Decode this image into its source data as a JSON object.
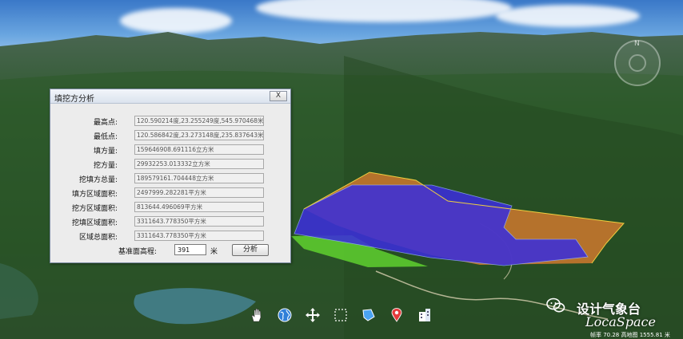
{
  "dialog": {
    "title": "填挖方分析",
    "close_label": "X",
    "fields": [
      {
        "label": "最高点:",
        "value": "120.590214度,23.255249度,545.970468米"
      },
      {
        "label": "最低点:",
        "value": "120.586842度,23.273148度,235.837643米"
      },
      {
        "label": "填方量:",
        "value": "159646908.691116立方米"
      },
      {
        "label": "挖方量:",
        "value": "29932253.013332立方米"
      },
      {
        "label": "挖填方总量:",
        "value": "189579161.704448立方米"
      },
      {
        "label": "填方区域面积:",
        "value": "2497999.282281平方米"
      },
      {
        "label": "挖方区域面积:",
        "value": "813644.496069平方米"
      },
      {
        "label": "挖填区域面积:",
        "value": "3311643.778350平方米"
      },
      {
        "label": "区域总面积:",
        "value": "3311643.778350平方米"
      }
    ],
    "base_label": "基准面高程:",
    "base_value": "391",
    "unit": "米",
    "analyze_button": "分析"
  },
  "toolbar": {
    "icons": [
      "hand-pan-icon",
      "globe-icon",
      "move-arrows-icon",
      "select-rectangle-icon",
      "area-measure-icon",
      "location-pin-icon",
      "building-icon"
    ]
  },
  "compass": {
    "north_label": "N"
  },
  "watermark": {
    "text": "设计气象台",
    "brand": "LocaSpace"
  },
  "status_bar": {
    "text": "帧率 70.28  高地图 1555.81 米"
  },
  "colors": {
    "fill_area": "#3b2fd9",
    "cut_area": "#c9782e",
    "green_face": "#5fd12f",
    "dialog_bg": "#ececec"
  }
}
